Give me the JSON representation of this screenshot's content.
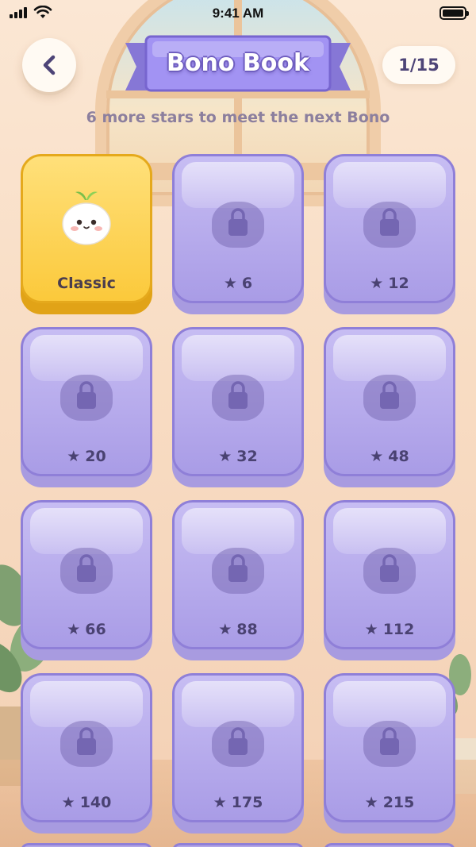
{
  "status_bar": {
    "time": "9:41 AM"
  },
  "header": {
    "title": "Bono Book",
    "progress": "1/15",
    "subtitle": "6 more stars to meet the next Bono"
  },
  "colors": {
    "locked_card": "#a99ce6",
    "locked_border": "#8f7fd8",
    "unlocked_card": "#fbc93b",
    "banner": "#9d8ef0",
    "text_dark": "#4a4272"
  },
  "cards": [
    {
      "state": "unlocked",
      "label": "Classic",
      "icon": "bono-character-icon"
    },
    {
      "state": "locked",
      "cost": "6",
      "icon": "lock-icon"
    },
    {
      "state": "locked",
      "cost": "12",
      "icon": "lock-icon"
    },
    {
      "state": "locked",
      "cost": "20",
      "icon": "lock-icon"
    },
    {
      "state": "locked",
      "cost": "32",
      "icon": "lock-icon"
    },
    {
      "state": "locked",
      "cost": "48",
      "icon": "lock-icon"
    },
    {
      "state": "locked",
      "cost": "66",
      "icon": "lock-icon"
    },
    {
      "state": "locked",
      "cost": "88",
      "icon": "lock-icon"
    },
    {
      "state": "locked",
      "cost": "112",
      "icon": "lock-icon"
    },
    {
      "state": "locked",
      "cost": "140",
      "icon": "lock-icon"
    },
    {
      "state": "locked",
      "cost": "175",
      "icon": "lock-icon"
    },
    {
      "state": "locked",
      "cost": "215",
      "icon": "lock-icon"
    }
  ]
}
